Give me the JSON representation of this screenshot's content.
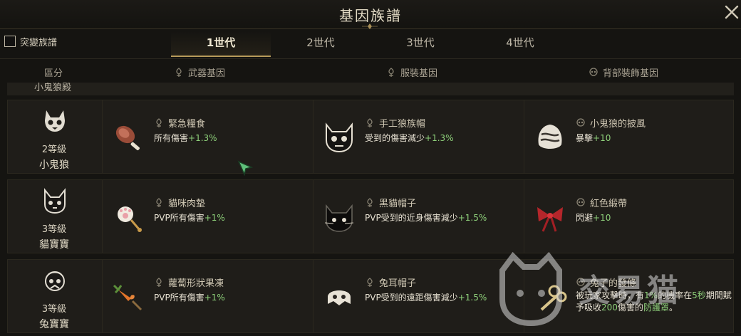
{
  "window": {
    "title": "基因族譜"
  },
  "toggle": {
    "label": "突變族譜",
    "checked": false
  },
  "tabs": [
    {
      "label": "1世代",
      "active": true
    },
    {
      "label": "2世代",
      "active": false
    },
    {
      "label": "3世代",
      "active": false
    },
    {
      "label": "4世代",
      "active": false
    }
  ],
  "columns": {
    "category": "區分",
    "weapon": "武器基因",
    "outfit": "服裝基因",
    "back": "背部裝飾基因"
  },
  "partial_row_label": "小鬼狼殿",
  "rows": [
    {
      "category": {
        "icon": "wolf-skull-icon",
        "level": "2等級",
        "name": "小鬼狼"
      },
      "weapon": {
        "icon": "meat-leg-icon",
        "name": "緊急糧食",
        "effect": "所有傷害",
        "value": "+1.3%"
      },
      "outfit": {
        "icon": "wolf-hat-icon",
        "name": "手工狼族帽",
        "effect": "受到的傷害減少",
        "value": "+1.3%"
      },
      "back": {
        "icon": "wolf-cape-icon",
        "name": "小鬼狼的披風",
        "effect": "暴擊",
        "value": "+10"
      }
    },
    {
      "category": {
        "icon": "cat-face-icon",
        "level": "3等級",
        "name": "貓寶寶"
      },
      "weapon": {
        "icon": "paw-pad-icon",
        "name": "貓咪肉墊",
        "effect": "PVP所有傷害",
        "value": "+1%"
      },
      "outfit": {
        "icon": "black-cat-hat-icon",
        "name": "黑貓帽子",
        "effect": "PVP受到的近身傷害減少",
        "value": "+1.5%"
      },
      "back": {
        "icon": "red-ribbon-icon",
        "name": "紅色緞帶",
        "effect": "閃避",
        "value": "+10"
      }
    },
    {
      "category": {
        "icon": "rabbit-face-icon",
        "level": "3等級",
        "name": "兔寶寶"
      },
      "weapon": {
        "icon": "carrot-icon",
        "name": "蘿蔔形狀果凍",
        "effect": "PVP所有傷害",
        "value": "+1%"
      },
      "outfit": {
        "icon": "bunny-hat-icon",
        "name": "兔耳帽子",
        "effect": "PVP受到的遠距傷害減少",
        "value": "+1.5%"
      },
      "back": {
        "icon": "wind-up-key-icon",
        "name": "兔子的發條",
        "effect_a": "被玩家攻擊時，有",
        "effect_b": "1%",
        "effect_c": "的機率在",
        "effect_d": "5秒",
        "effect_e": "期間賦予吸收",
        "effect_f": "200",
        "effect_g": "傷害的",
        "effect_h": "防護罩",
        "effect_i": "。"
      }
    }
  ],
  "watermark": {
    "text": "交易猫"
  },
  "colors": {
    "accent": "#b79a5a",
    "value_green": "#8ed07a",
    "background": "#151411"
  }
}
